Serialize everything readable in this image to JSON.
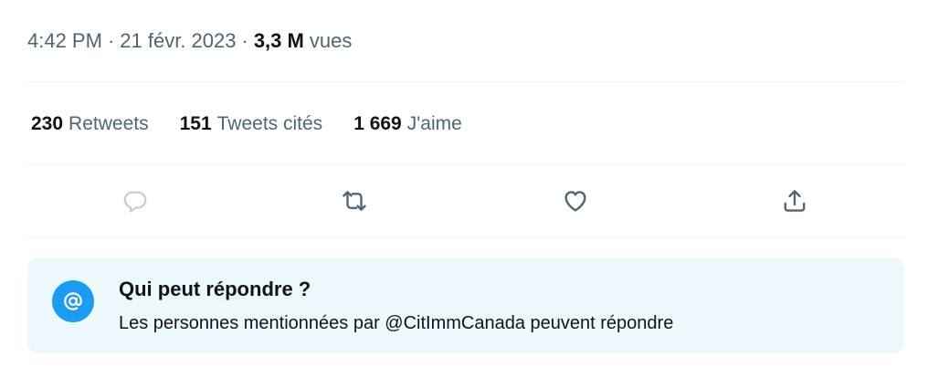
{
  "meta": {
    "time": "4:42 PM",
    "separator": "·",
    "date": "21 févr. 2023",
    "views_count": "3,3 M",
    "views_label": "vues"
  },
  "stats": {
    "retweets": {
      "count": "230",
      "label": "Retweets"
    },
    "quotes": {
      "count": "151",
      "label": "Tweets cités"
    },
    "likes": {
      "count": "1 669",
      "label": "J'aime"
    }
  },
  "actions": [
    {
      "icon": "reply-icon"
    },
    {
      "icon": "retweet-icon"
    },
    {
      "icon": "heart-icon"
    },
    {
      "icon": "share-icon"
    }
  ],
  "reply_restriction": {
    "icon": "at-sign-icon",
    "title": "Qui peut répondre ?",
    "description": "Les personnes mentionnées par @CitImmCanada peuvent répondre"
  },
  "colors": {
    "text_primary": "#0f1419",
    "text_secondary": "#536471",
    "divider": "#eff3f4",
    "accent": "#1d9bf0",
    "card_background": "#edf8fd",
    "disabled_icon": "#c4cfd6"
  }
}
